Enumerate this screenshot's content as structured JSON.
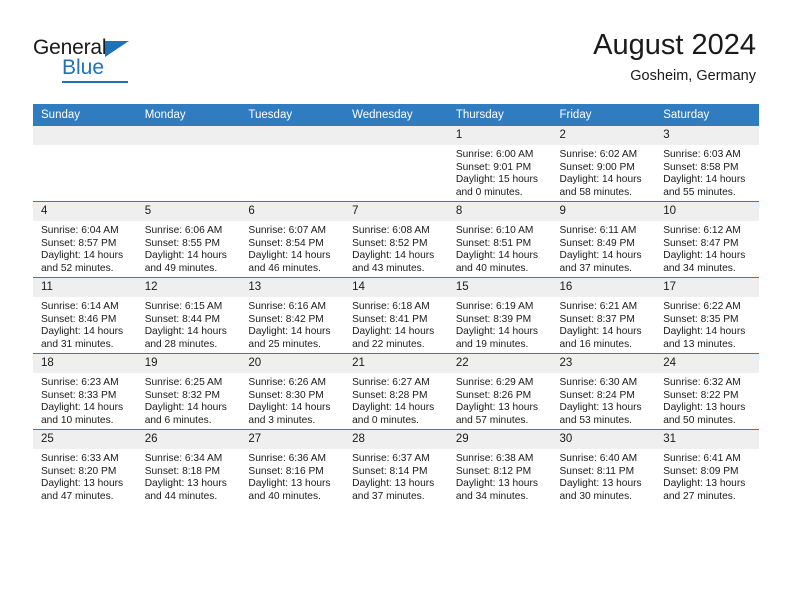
{
  "logo": {
    "word_one": "General",
    "word_two": "Blue",
    "triangle_color": "#1f72b8"
  },
  "header": {
    "title": "August 2024",
    "location": "Gosheim, Germany",
    "accent_color": "#2f7cc0"
  },
  "weekday_headers": [
    "Sunday",
    "Monday",
    "Tuesday",
    "Wednesday",
    "Thursday",
    "Friday",
    "Saturday"
  ],
  "labels": {
    "sunrise": "Sunrise:",
    "sunset": "Sunset:",
    "daylight": "Daylight:"
  },
  "weeks": [
    [
      {
        "day": "",
        "empty": true
      },
      {
        "day": "",
        "empty": true
      },
      {
        "day": "",
        "empty": true
      },
      {
        "day": "",
        "empty": true
      },
      {
        "day": "1",
        "sunrise": "Sunrise: 6:00 AM",
        "sunset": "Sunset: 9:01 PM",
        "daylight": "Daylight: 15 hours and 0 minutes."
      },
      {
        "day": "2",
        "sunrise": "Sunrise: 6:02 AM",
        "sunset": "Sunset: 9:00 PM",
        "daylight": "Daylight: 14 hours and 58 minutes."
      },
      {
        "day": "3",
        "sunrise": "Sunrise: 6:03 AM",
        "sunset": "Sunset: 8:58 PM",
        "daylight": "Daylight: 14 hours and 55 minutes."
      }
    ],
    [
      {
        "day": "4",
        "sunrise": "Sunrise: 6:04 AM",
        "sunset": "Sunset: 8:57 PM",
        "daylight": "Daylight: 14 hours and 52 minutes."
      },
      {
        "day": "5",
        "sunrise": "Sunrise: 6:06 AM",
        "sunset": "Sunset: 8:55 PM",
        "daylight": "Daylight: 14 hours and 49 minutes."
      },
      {
        "day": "6",
        "sunrise": "Sunrise: 6:07 AM",
        "sunset": "Sunset: 8:54 PM",
        "daylight": "Daylight: 14 hours and 46 minutes."
      },
      {
        "day": "7",
        "sunrise": "Sunrise: 6:08 AM",
        "sunset": "Sunset: 8:52 PM",
        "daylight": "Daylight: 14 hours and 43 minutes."
      },
      {
        "day": "8",
        "sunrise": "Sunrise: 6:10 AM",
        "sunset": "Sunset: 8:51 PM",
        "daylight": "Daylight: 14 hours and 40 minutes."
      },
      {
        "day": "9",
        "sunrise": "Sunrise: 6:11 AM",
        "sunset": "Sunset: 8:49 PM",
        "daylight": "Daylight: 14 hours and 37 minutes."
      },
      {
        "day": "10",
        "sunrise": "Sunrise: 6:12 AM",
        "sunset": "Sunset: 8:47 PM",
        "daylight": "Daylight: 14 hours and 34 minutes."
      }
    ],
    [
      {
        "day": "11",
        "sunrise": "Sunrise: 6:14 AM",
        "sunset": "Sunset: 8:46 PM",
        "daylight": "Daylight: 14 hours and 31 minutes."
      },
      {
        "day": "12",
        "sunrise": "Sunrise: 6:15 AM",
        "sunset": "Sunset: 8:44 PM",
        "daylight": "Daylight: 14 hours and 28 minutes."
      },
      {
        "day": "13",
        "sunrise": "Sunrise: 6:16 AM",
        "sunset": "Sunset: 8:42 PM",
        "daylight": "Daylight: 14 hours and 25 minutes."
      },
      {
        "day": "14",
        "sunrise": "Sunrise: 6:18 AM",
        "sunset": "Sunset: 8:41 PM",
        "daylight": "Daylight: 14 hours and 22 minutes."
      },
      {
        "day": "15",
        "sunrise": "Sunrise: 6:19 AM",
        "sunset": "Sunset: 8:39 PM",
        "daylight": "Daylight: 14 hours and 19 minutes."
      },
      {
        "day": "16",
        "sunrise": "Sunrise: 6:21 AM",
        "sunset": "Sunset: 8:37 PM",
        "daylight": "Daylight: 14 hours and 16 minutes."
      },
      {
        "day": "17",
        "sunrise": "Sunrise: 6:22 AM",
        "sunset": "Sunset: 8:35 PM",
        "daylight": "Daylight: 14 hours and 13 minutes."
      }
    ],
    [
      {
        "day": "18",
        "sunrise": "Sunrise: 6:23 AM",
        "sunset": "Sunset: 8:33 PM",
        "daylight": "Daylight: 14 hours and 10 minutes."
      },
      {
        "day": "19",
        "sunrise": "Sunrise: 6:25 AM",
        "sunset": "Sunset: 8:32 PM",
        "daylight": "Daylight: 14 hours and 6 minutes."
      },
      {
        "day": "20",
        "sunrise": "Sunrise: 6:26 AM",
        "sunset": "Sunset: 8:30 PM",
        "daylight": "Daylight: 14 hours and 3 minutes."
      },
      {
        "day": "21",
        "sunrise": "Sunrise: 6:27 AM",
        "sunset": "Sunset: 8:28 PM",
        "daylight": "Daylight: 14 hours and 0 minutes."
      },
      {
        "day": "22",
        "sunrise": "Sunrise: 6:29 AM",
        "sunset": "Sunset: 8:26 PM",
        "daylight": "Daylight: 13 hours and 57 minutes."
      },
      {
        "day": "23",
        "sunrise": "Sunrise: 6:30 AM",
        "sunset": "Sunset: 8:24 PM",
        "daylight": "Daylight: 13 hours and 53 minutes."
      },
      {
        "day": "24",
        "sunrise": "Sunrise: 6:32 AM",
        "sunset": "Sunset: 8:22 PM",
        "daylight": "Daylight: 13 hours and 50 minutes."
      }
    ],
    [
      {
        "day": "25",
        "sunrise": "Sunrise: 6:33 AM",
        "sunset": "Sunset: 8:20 PM",
        "daylight": "Daylight: 13 hours and 47 minutes."
      },
      {
        "day": "26",
        "sunrise": "Sunrise: 6:34 AM",
        "sunset": "Sunset: 8:18 PM",
        "daylight": "Daylight: 13 hours and 44 minutes."
      },
      {
        "day": "27",
        "sunrise": "Sunrise: 6:36 AM",
        "sunset": "Sunset: 8:16 PM",
        "daylight": "Daylight: 13 hours and 40 minutes."
      },
      {
        "day": "28",
        "sunrise": "Sunrise: 6:37 AM",
        "sunset": "Sunset: 8:14 PM",
        "daylight": "Daylight: 13 hours and 37 minutes."
      },
      {
        "day": "29",
        "sunrise": "Sunrise: 6:38 AM",
        "sunset": "Sunset: 8:12 PM",
        "daylight": "Daylight: 13 hours and 34 minutes."
      },
      {
        "day": "30",
        "sunrise": "Sunrise: 6:40 AM",
        "sunset": "Sunset: 8:11 PM",
        "daylight": "Daylight: 13 hours and 30 minutes."
      },
      {
        "day": "31",
        "sunrise": "Sunrise: 6:41 AM",
        "sunset": "Sunset: 8:09 PM",
        "daylight": "Daylight: 13 hours and 27 minutes."
      }
    ]
  ]
}
